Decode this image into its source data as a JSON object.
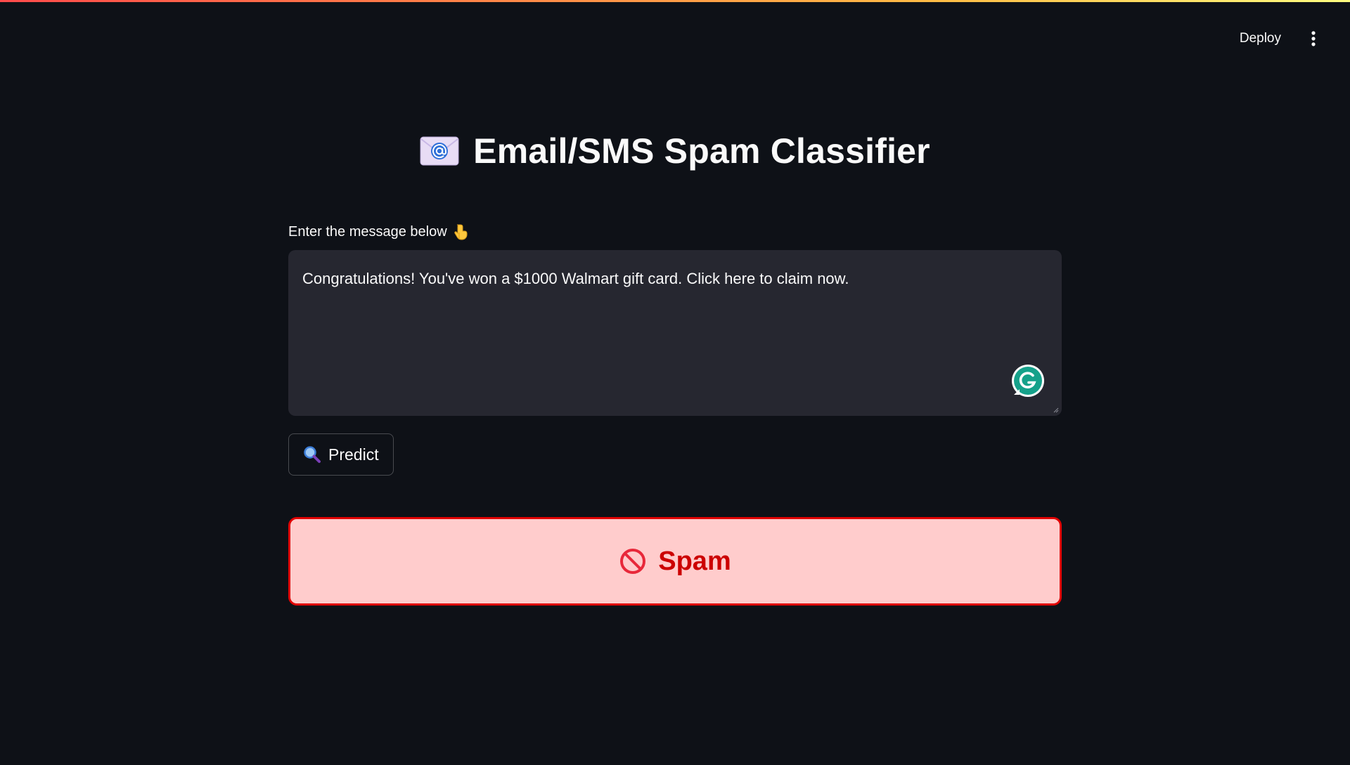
{
  "toolbar": {
    "deploy_label": "Deploy",
    "menu_icon": "kebab-menu-icon"
  },
  "header": {
    "title": "Email/SMS Spam Classifier",
    "title_icon": "email-at-icon"
  },
  "form": {
    "label": "Enter the message below",
    "label_icon": "pointing-down-hand-icon",
    "message_value": "Congratulations! You've won a $1000 Walmart gift card. Click here to claim now.",
    "predict_label": "Predict",
    "predict_icon": "magnifying-glass-icon"
  },
  "result": {
    "label": "Spam",
    "icon": "prohibited-icon",
    "colors": {
      "background": "#ffcccc",
      "border": "#e00000",
      "text": "#cc0000"
    }
  },
  "theme": {
    "background": "#0e1117",
    "input_background": "#262730",
    "text": "#fafafa"
  }
}
